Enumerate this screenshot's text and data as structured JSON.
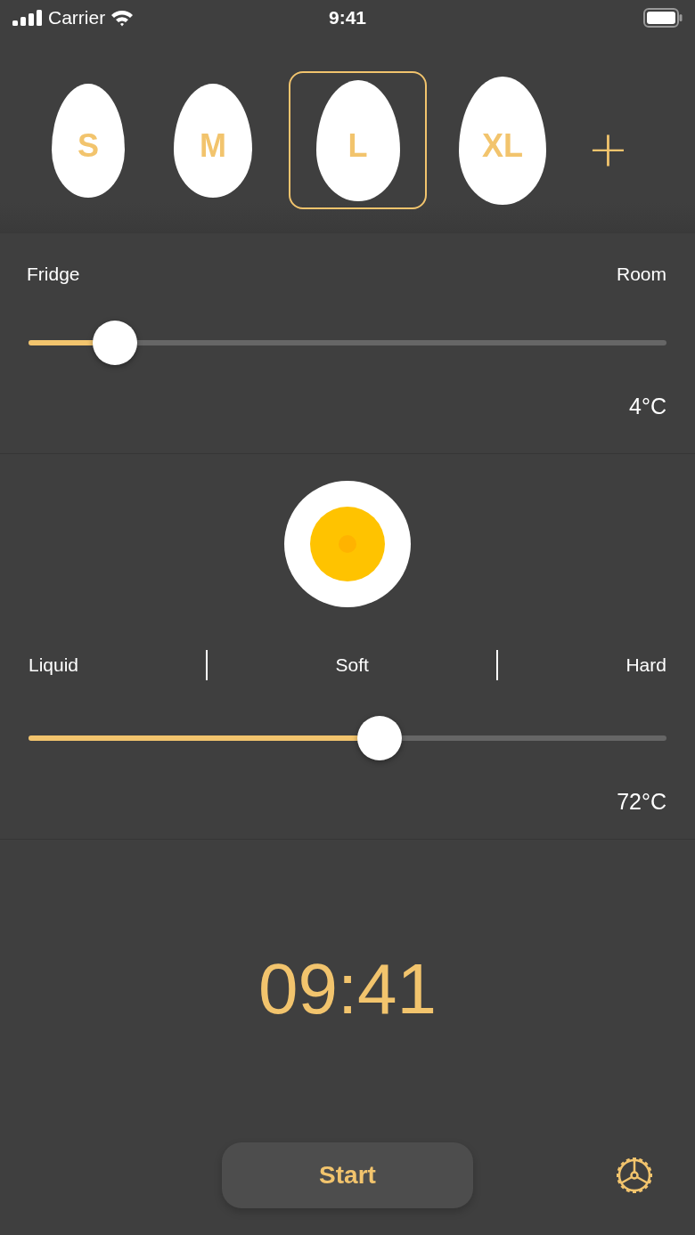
{
  "status_bar": {
    "carrier": "Carrier",
    "time": "9:41"
  },
  "egg_sizes": [
    {
      "label": "S",
      "selected": false
    },
    {
      "label": "M",
      "selected": false
    },
    {
      "label": "L",
      "selected": true
    },
    {
      "label": "XL",
      "selected": false
    }
  ],
  "add_button": {
    "label": "+"
  },
  "temperature": {
    "min_label": "Fridge",
    "max_label": "Room",
    "level": 0.135,
    "reading": "4°C"
  },
  "doneness": {
    "labels": [
      "Liquid",
      "Soft",
      "Hard"
    ],
    "level": 0.55,
    "reading": "72°C"
  },
  "timer": "09:41",
  "start_button": {
    "label": "Start"
  }
}
